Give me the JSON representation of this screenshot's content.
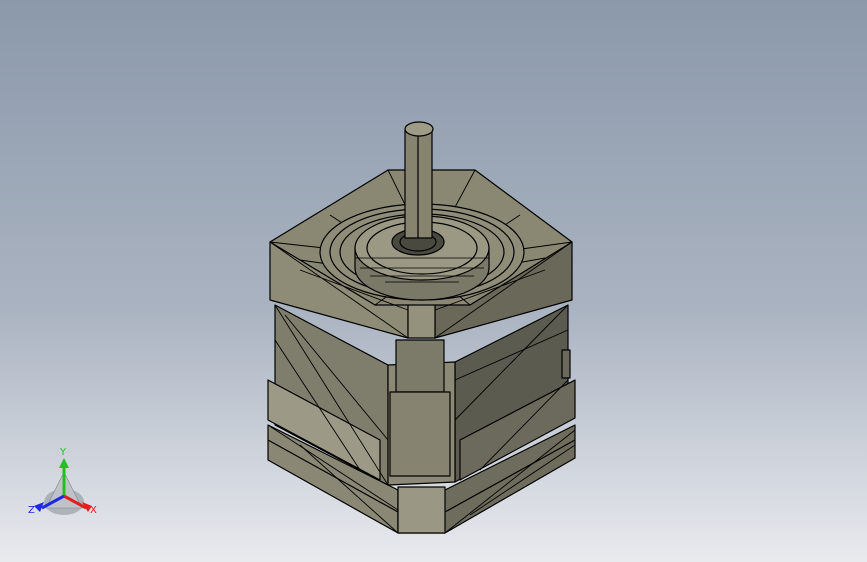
{
  "viewport": {
    "background_top": "#8b99ab",
    "background_bottom": "#e8eaee",
    "model_face_color": "#84826f",
    "model_edge_color": "#000000"
  },
  "triad": {
    "labels": {
      "x": "X",
      "y": "Y",
      "z": "Z"
    },
    "colors": {
      "x": "#e01f1f",
      "y": "#22c022",
      "z": "#1f2ae0"
    }
  }
}
